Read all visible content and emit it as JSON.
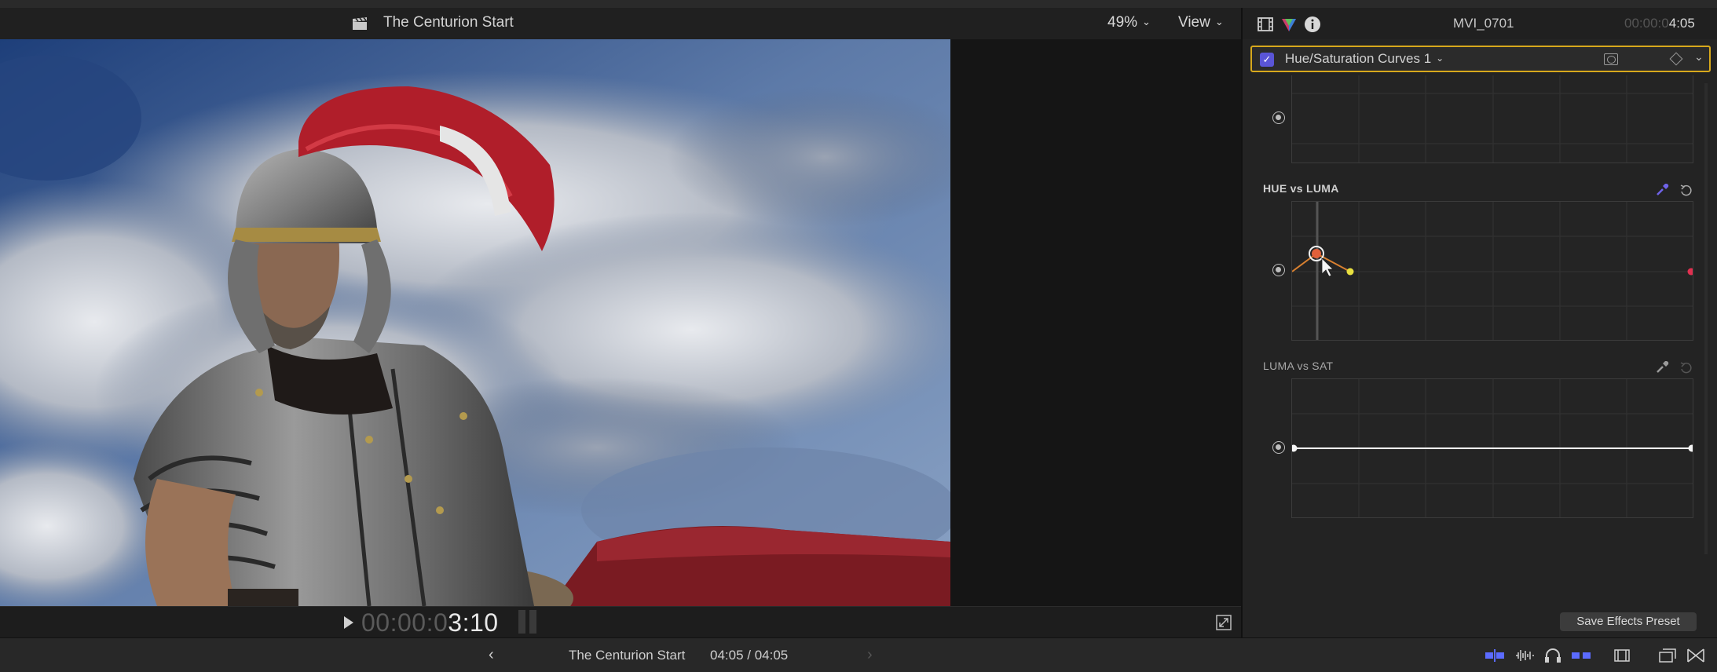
{
  "viewer": {
    "title": "The Centurion Start",
    "zoom": "49%",
    "view_label": "View",
    "timecode_dim": "00:00:0",
    "timecode_bright": "3:10"
  },
  "inspector": {
    "clip_name": "MVI_0701",
    "timecode_dim": "00:00:0",
    "timecode_bright": "4:05",
    "effect_name": "Hue/Saturation Curves 1",
    "sections": {
      "hue_vs_luma": "HUE vs LUMA",
      "luma_vs_sat": "LUMA vs SAT"
    },
    "save_preset_label": "Save Effects Preset"
  },
  "bottom_bar": {
    "project_name": "The Centurion Start",
    "duration": "04:05 / 04:05"
  },
  "colors": {
    "selection_outline": "#d7a81c",
    "checkbox": "#5a55d6",
    "eyedropper_active": "#6f63e8",
    "toolbar_blue": "#5b6bff"
  },
  "icons": [
    "clapper-icon",
    "chevron-down-icon",
    "play-icon",
    "fullscreen-icon",
    "film-icon",
    "color-icon",
    "info-icon",
    "mask-icon",
    "keyframe-icon",
    "eyedropper-icon",
    "reset-icon",
    "chevron-left-icon",
    "chevron-right-icon",
    "audio-waveform-icon",
    "headphones-icon",
    "skimming-icon",
    "browser-icon",
    "timeline-icon",
    "transitions-icon"
  ]
}
